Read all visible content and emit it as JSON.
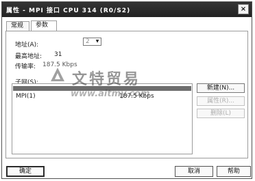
{
  "window": {
    "title": "属性 - MPI 接口 CPU 314 (R0/S2)",
    "close_glyph": "×"
  },
  "tabs": [
    {
      "label": "常规"
    },
    {
      "label": "参数"
    }
  ],
  "params": {
    "address_label": "地址(A):",
    "address_value": "2",
    "max_address_label": "最高地址:",
    "max_address_value": "31",
    "rate_label": "传输率:",
    "rate_value": "187.5 Kbps",
    "subnet_label": "子网(S):"
  },
  "subnet_list": {
    "items": [
      {
        "name": "MPI(1)",
        "speed": "187.5 Kbps"
      }
    ]
  },
  "side_buttons": {
    "new": "新建(N)...",
    "properties": "属性(R)...",
    "delete": "删除(L)"
  },
  "footer": {
    "ok": "确定",
    "cancel": "取消",
    "help": "帮助"
  },
  "watermark": {
    "text": "文特贸易",
    "url": "www.aitmy.com"
  }
}
